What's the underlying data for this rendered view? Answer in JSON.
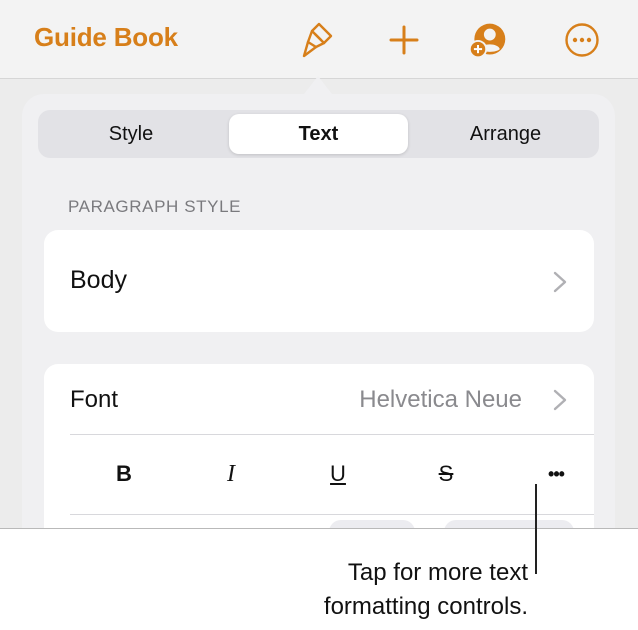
{
  "toolbar": {
    "title": "Guide Book",
    "icons": [
      "paintbrush-icon",
      "plus-icon",
      "add-collaborator-icon",
      "more-icon"
    ],
    "accent_color": "#d77f1a"
  },
  "format_panel": {
    "tabs": [
      {
        "label": "Style",
        "selected": false
      },
      {
        "label": "Text",
        "selected": true
      },
      {
        "label": "Arrange",
        "selected": false
      }
    ],
    "paragraph_style": {
      "section_label": "PARAGRAPH STYLE",
      "value": "Body"
    },
    "font": {
      "label": "Font",
      "value": "Helvetica Neue"
    },
    "format_buttons": [
      "B",
      "I",
      "U",
      "S",
      "•••"
    ]
  },
  "callout": {
    "line1": "Tap for more text",
    "line2": "formatting controls."
  }
}
